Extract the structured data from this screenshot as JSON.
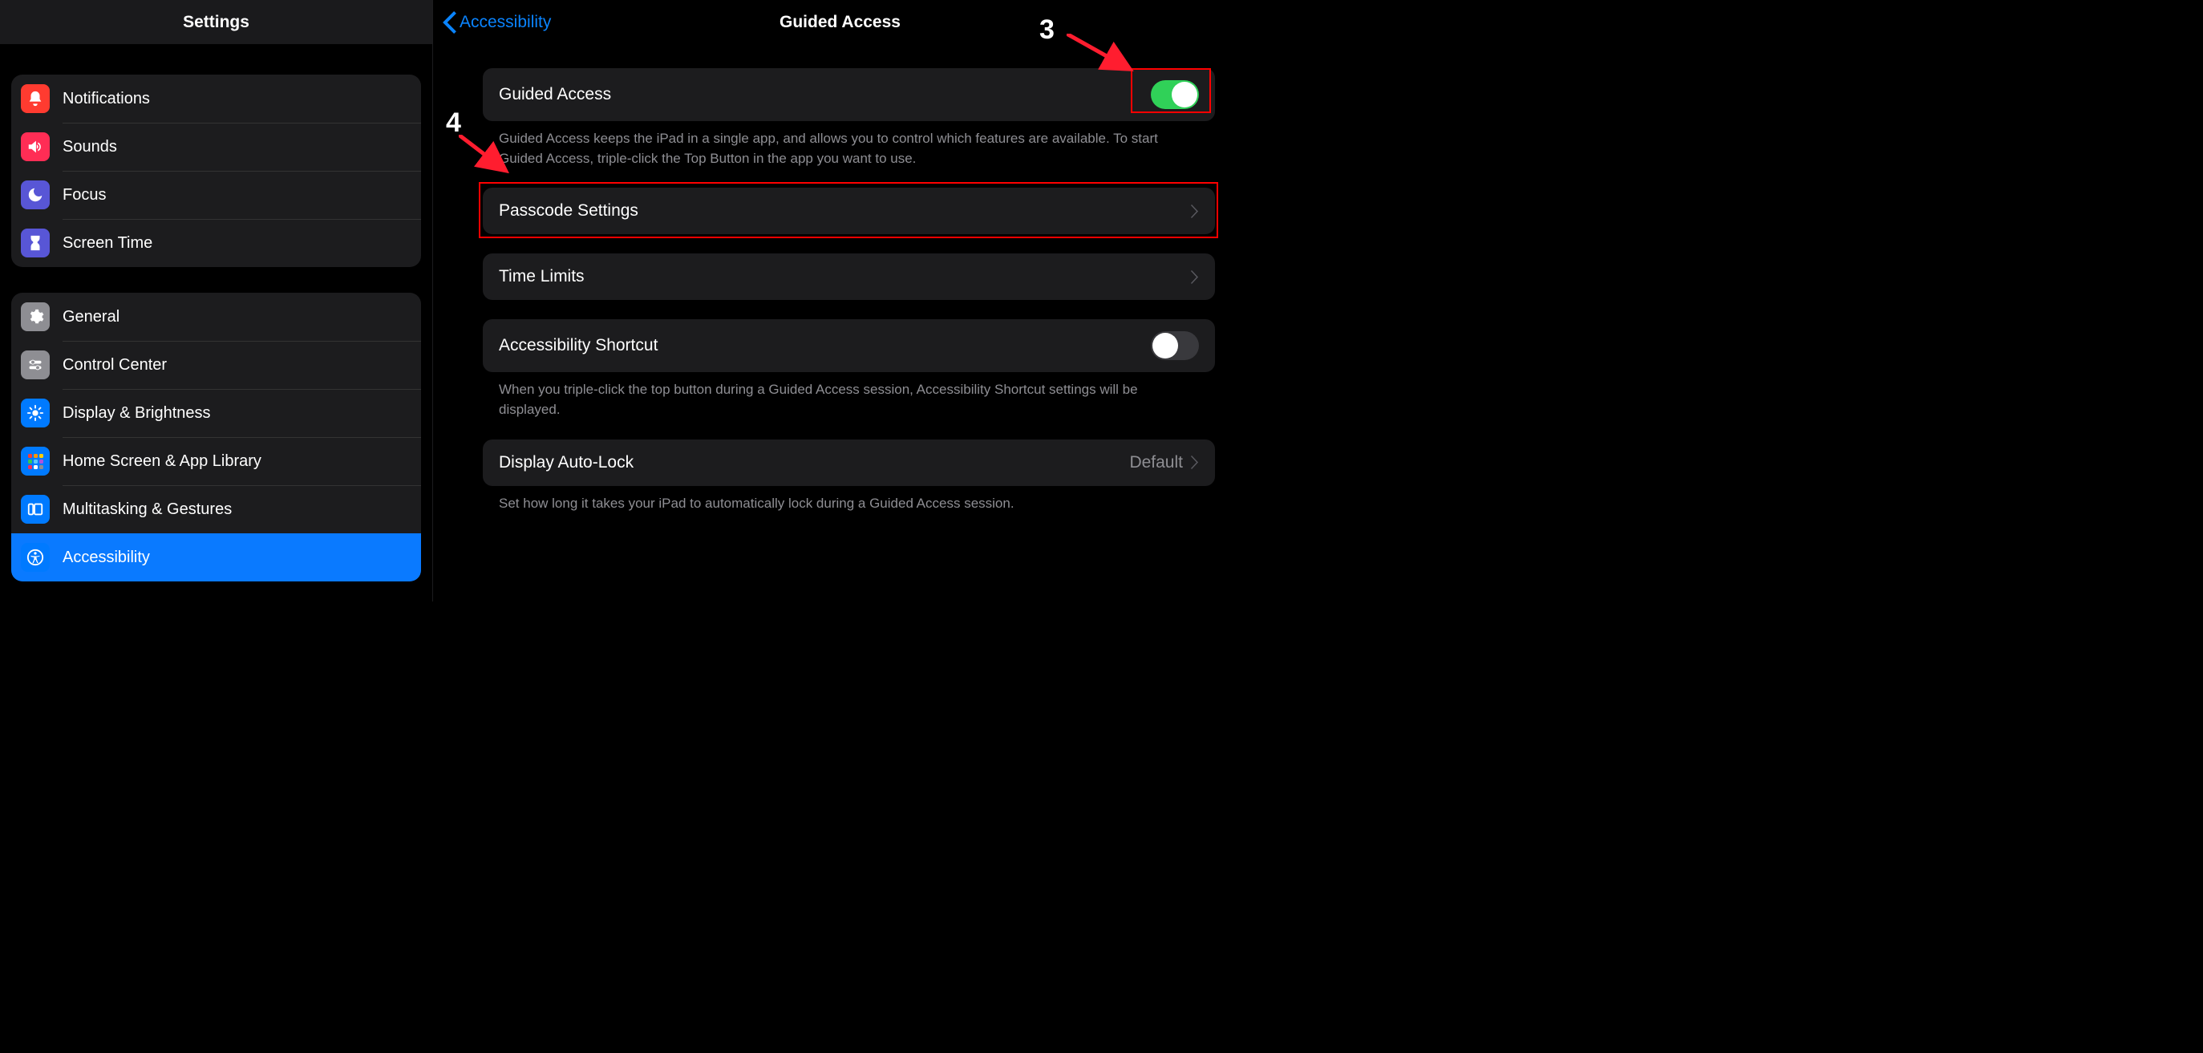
{
  "sidebar": {
    "title": "Settings",
    "group1": {
      "notifications": "Notifications",
      "sounds": "Sounds",
      "focus": "Focus",
      "screen_time": "Screen Time"
    },
    "group2": {
      "general": "General",
      "control_center": "Control Center",
      "display_brightness": "Display & Brightness",
      "home_screen": "Home Screen & App Library",
      "multitasking": "Multitasking & Gestures",
      "accessibility": "Accessibility"
    }
  },
  "detail": {
    "back_label": "Accessibility",
    "title": "Guided Access",
    "sec1": {
      "row_label": "Guided Access",
      "footer": "Guided Access keeps the iPad in a single app, and allows you to control which features are available. To start Guided Access, triple-click the Top Button in the app you want to use."
    },
    "sec2": {
      "row_label": "Passcode Settings"
    },
    "sec3": {
      "row_label": "Time Limits"
    },
    "sec4": {
      "row_label": "Accessibility Shortcut",
      "footer": "When you triple-click the top button during a Guided Access session, Accessibility Shortcut settings will be displayed."
    },
    "sec5": {
      "row_label": "Display Auto-Lock",
      "value": "Default",
      "footer": "Set how long it takes your iPad to automatically lock during a Guided Access session."
    }
  },
  "annotations": {
    "num3": "3",
    "num4": "4"
  }
}
